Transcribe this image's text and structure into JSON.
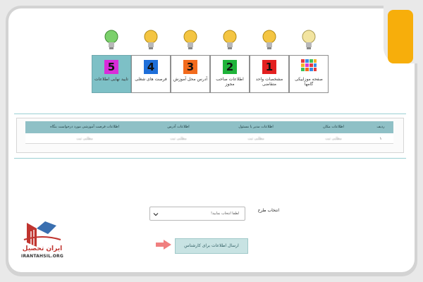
{
  "colors": {
    "accent_orange": "#f7ae0b",
    "teal": "#8fc0c6",
    "step_active": "#7dc0c6",
    "brand_red": "#c0342f"
  },
  "steps": [
    {
      "number": "",
      "label": "صفحه موزاییکی گامها",
      "icon": "mosaic-grid-icon",
      "bulb": "lightbulb-icon",
      "bulb_color": "#f2e4a0"
    },
    {
      "number": "1",
      "label": "مشخصات واحد متقاضی",
      "color": "#e32020",
      "bulb": "lightbulb-icon",
      "bulb_color": "#f4c542"
    },
    {
      "number": "2",
      "label": "اطلاعات صاحب مجوز",
      "color": "#1fb33a",
      "bulb": "lightbulb-icon",
      "bulb_color": "#f4c542"
    },
    {
      "number": "3",
      "label": "آدرس محل آموزش",
      "color": "#f26b1d",
      "bulb": "lightbulb-icon",
      "bulb_color": "#f4c542"
    },
    {
      "number": "4",
      "label": "فرصت های شغلی",
      "color": "#1e6fd9",
      "bulb": "lightbulb-icon",
      "bulb_color": "#f4c542"
    },
    {
      "number": "5",
      "label": "تایید نهایی اطلاعات",
      "color": "#d92bd9",
      "bulb": "lightbulb-icon",
      "bulb_color": "#7bd06b"
    }
  ],
  "table": {
    "headers": [
      "ردیف",
      "اطلاعات مکان",
      "اطلاعات مدیر یا مسئول",
      "اطلاعات آدرس",
      "اطلاعات فرصت آموزشی مورد درخواست بنگاه"
    ],
    "rows": [
      [
        "۱",
        "مطلبی ثبت",
        "مطلبی ثبت",
        "مطلبی ثبت",
        "مطلبی ثبت"
      ]
    ]
  },
  "form": {
    "select_label": "انتخاب طرح",
    "select_value": "لطفا انتخاب نمایید!",
    "submit_label": "ارسال اطلاعات برای کارشناس"
  },
  "logo": {
    "title": "ایران تحصیل",
    "url": "IRANTAHSIL.ORG"
  }
}
